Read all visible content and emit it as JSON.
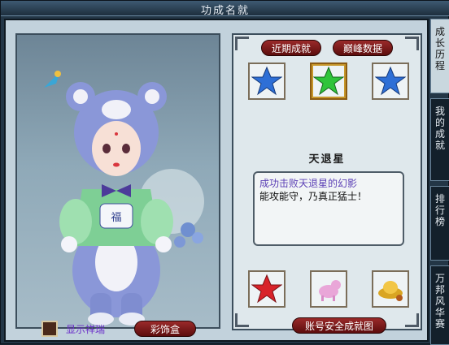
{
  "window": {
    "title": "功成名就"
  },
  "tabs": {
    "recent": "近期成就",
    "peak": "巅峰数据"
  },
  "side_tabs": [
    "成长历程",
    "我的成就",
    "排行榜",
    "万邦风华赛"
  ],
  "achievement": {
    "name": "天退星",
    "desc_line1": "成功击败天退星的幻影",
    "desc_line2": "能攻能守，乃真正猛士！"
  },
  "medals_top": [
    {
      "icon": "blue-star-icon",
      "color": "#2e6fd6"
    },
    {
      "icon": "green-star-icon",
      "color": "#2fc43a"
    },
    {
      "icon": "blue-star-icon",
      "color": "#2e6fd6"
    }
  ],
  "medals_bottom": [
    {
      "icon": "red-star-icon",
      "color": "#d8232a"
    },
    {
      "icon": "pink-pet-icon",
      "color": "#e9a6d8"
    },
    {
      "icon": "gold-ingot-icon",
      "color": "#d9a522"
    }
  ],
  "buttons": {
    "account_security": "账号安全成就图",
    "outfit_box": "彩饰盒"
  },
  "checkbox": {
    "label": "显示祥瑞"
  }
}
